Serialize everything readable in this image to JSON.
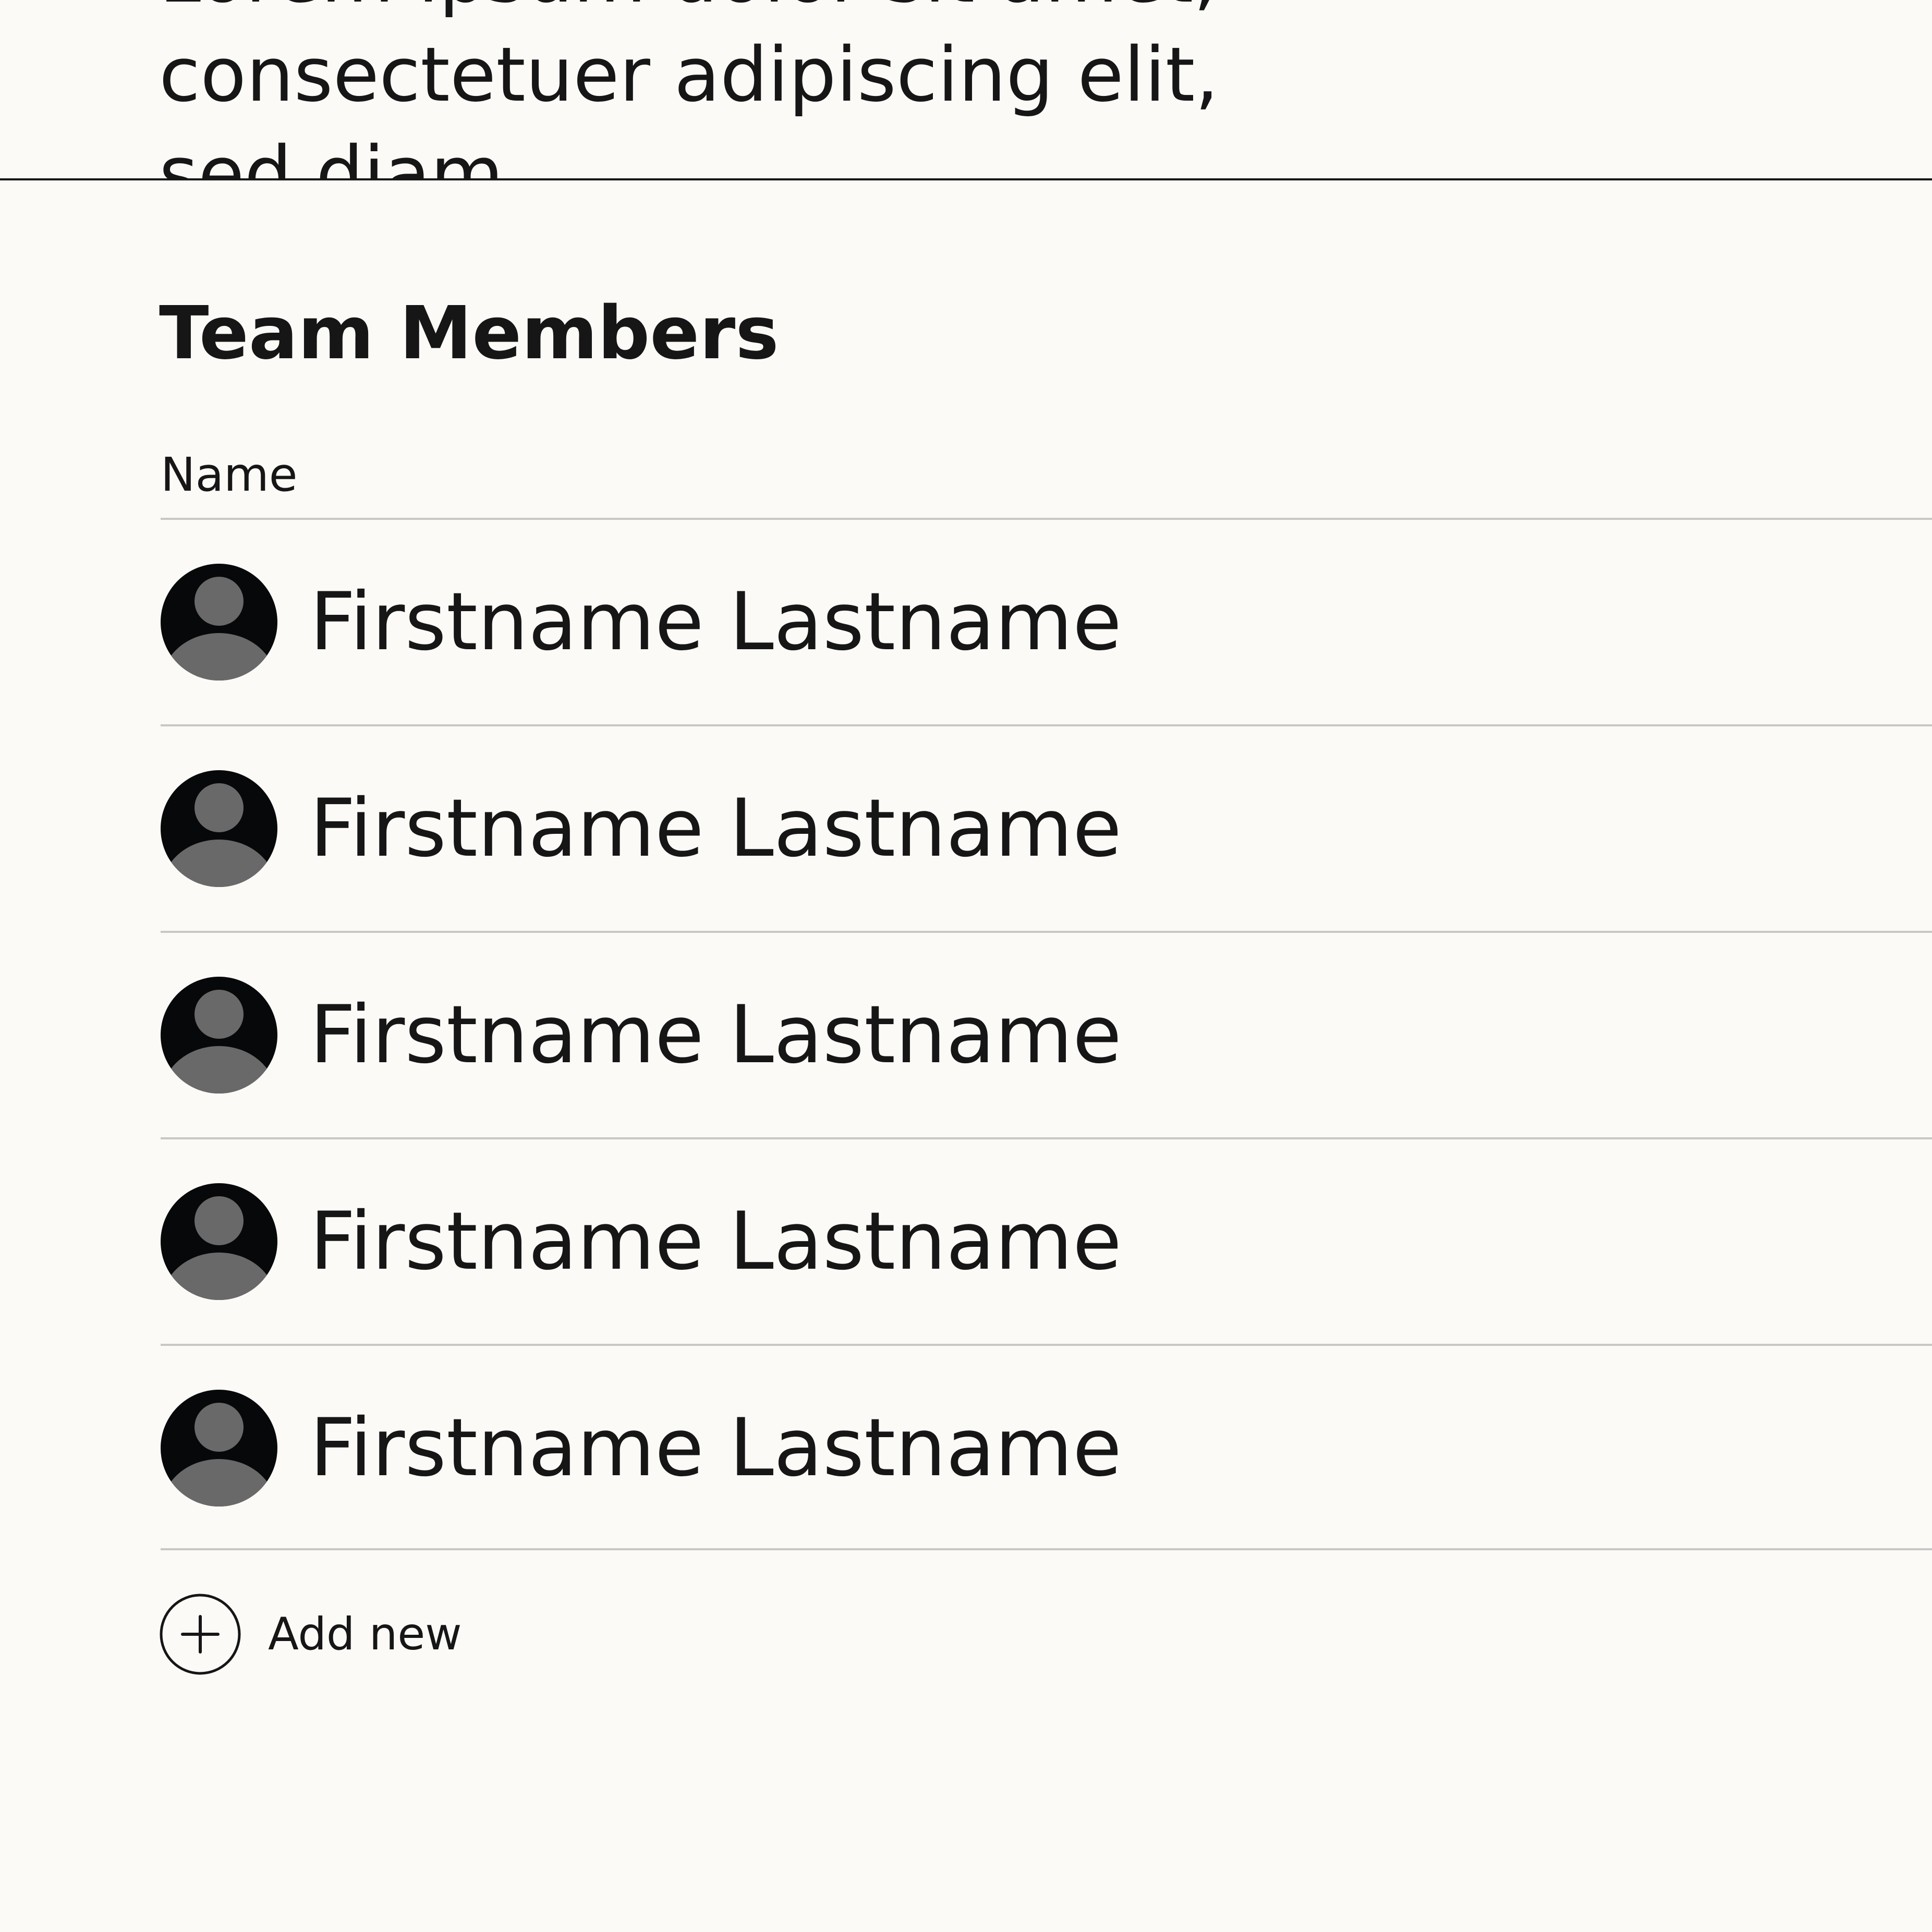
{
  "intro": {
    "text": "Lorem ipsum dolor sit amet, consectetuer adipiscing elit, sed diam"
  },
  "team": {
    "title": "Team Members",
    "column_name": "Name",
    "members": [
      {
        "name": "Firstname Lastname"
      },
      {
        "name": "Firstname Lastname"
      },
      {
        "name": "Firstname Lastname"
      },
      {
        "name": "Firstname Lastname"
      },
      {
        "name": "Firstname Lastname"
      }
    ],
    "add_label": "Add new"
  },
  "icons": {
    "avatar": "user-avatar-icon",
    "add": "plus-circle-icon"
  },
  "colors": {
    "background": "#fcfaf7",
    "text": "#161616",
    "avatar_dark": "#06080a",
    "avatar_light": "#696969"
  }
}
